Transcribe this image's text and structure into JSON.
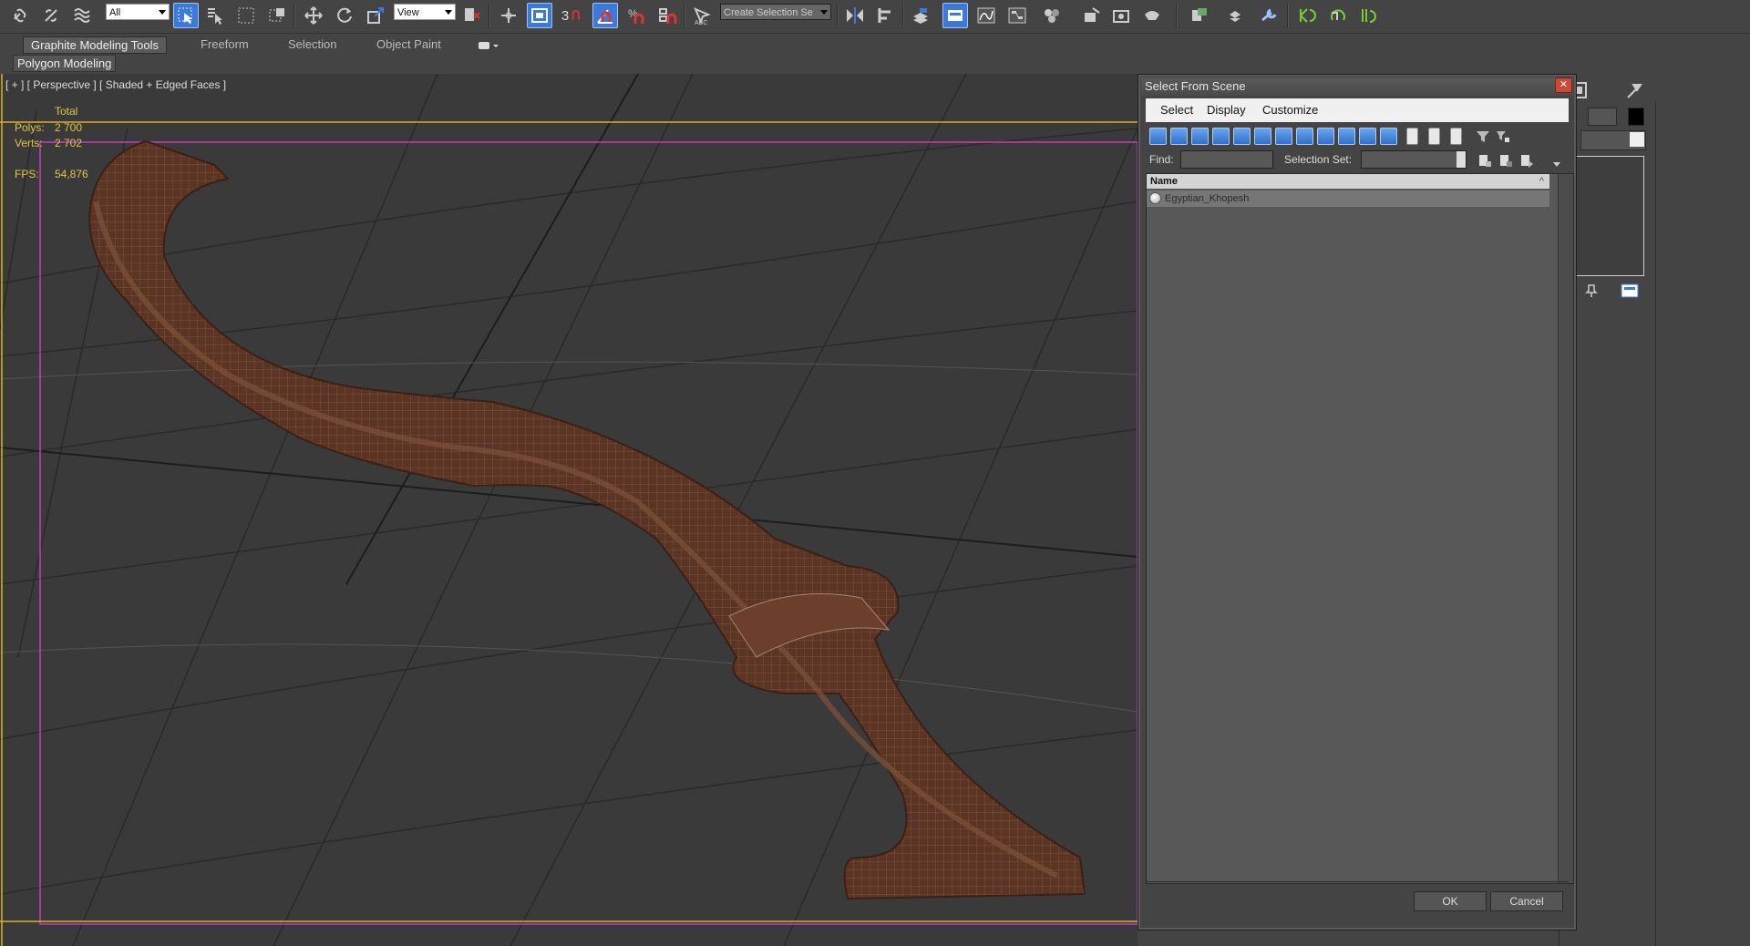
{
  "toolbar": {
    "filter_value": "All",
    "ref_coord_value": "View",
    "snap_label": "3",
    "selection_set_placeholder": "Create Selection Se"
  },
  "ribbon": {
    "tabs": [
      "Graphite Modeling Tools",
      "Freeform",
      "Selection",
      "Object Paint"
    ],
    "sub_panel": "Polygon Modeling"
  },
  "viewport": {
    "label": "[ + ] [ Perspective ] [ Shaded + Edged Faces ]",
    "stats": {
      "total_label": "Total",
      "polys_label": "Polys:",
      "polys_value": "2 700",
      "verts_label": "Verts:",
      "verts_value": "2 702",
      "fps_label": "FPS:",
      "fps_value": "54,876"
    },
    "model_color": "#5b3424"
  },
  "dialog": {
    "title": "Select From Scene",
    "menu": [
      "Select",
      "Display",
      "Customize"
    ],
    "find_label": "Find:",
    "selection_set_label": "Selection Set:",
    "column_name": "Name",
    "rows": [
      "Egyptian_Khopesh"
    ],
    "ok_label": "OK",
    "cancel_label": "Cancel"
  },
  "colors": {
    "accent": "#3b7ad9",
    "safe_frame": "#c040c0",
    "viewport_border": "#d9b22a",
    "stats_text": "#e2c54a"
  }
}
